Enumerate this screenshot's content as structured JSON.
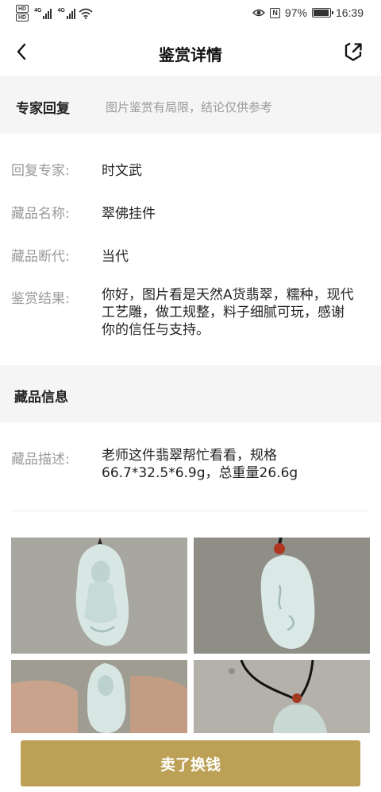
{
  "status_bar": {
    "network_1": "4G",
    "network_2": "4G",
    "battery_percent": "97%",
    "battery_level": 0.97,
    "time": "16:39",
    "icons": [
      "hd-icon",
      "signal-icon",
      "wifi-icon",
      "eye-icon",
      "nfc-icon",
      "battery-icon"
    ]
  },
  "header": {
    "title": "鉴赏详情",
    "back_icon": "chevron-left-icon",
    "share_icon": "share-icon"
  },
  "expert_reply": {
    "title": "专家回复",
    "note": "图片鉴赏有局限，结论仅供参考",
    "rows": [
      {
        "label": "回复专家:",
        "value": "时文武"
      },
      {
        "label": "藏品名称:",
        "value": "翠佛挂件"
      },
      {
        "label": "藏品断代:",
        "value": "当代"
      },
      {
        "label": "鉴赏结果:",
        "value": "你好，图片看是天然A货翡翠，糯种，现代工艺雕，做工规整，料子细腻可玩，感谢你的信任与支持。"
      }
    ]
  },
  "collection_info": {
    "title": "藏品信息",
    "description_label": "藏品描述:",
    "description": "老师这件翡翠帮忙看看，规格66.7*32.5*6.9g，总重量26.6g"
  },
  "photos": [
    "jade-buddha-front",
    "jade-pendant-back",
    "jade-in-hand",
    "jade-on-cord"
  ],
  "colors": {
    "accent": "#bca055",
    "band_bg": "#f5f5f5",
    "label_gray": "#9a9a9a"
  },
  "actions": {
    "sell_label": "卖了换钱"
  }
}
